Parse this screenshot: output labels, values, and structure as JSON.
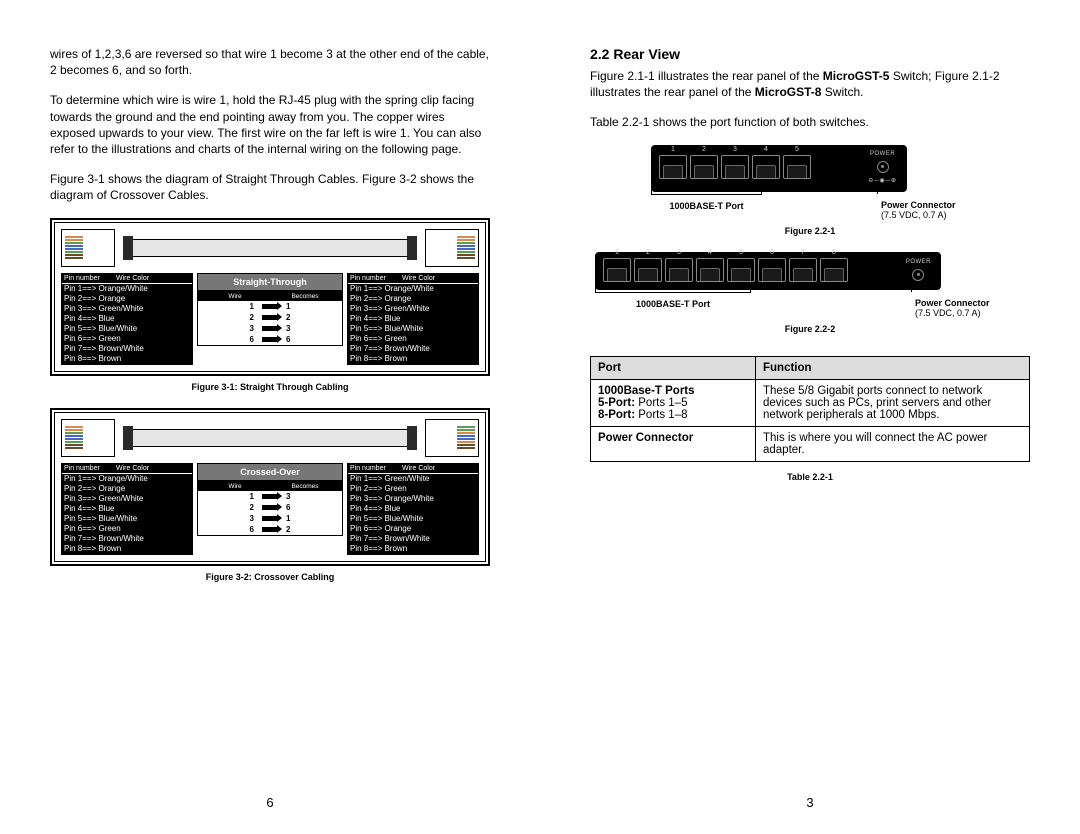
{
  "left": {
    "para1": "wires of 1,2,3,6 are reversed so that wire 1 become 3 at the other end of the cable, 2 becomes 6, and so forth.",
    "para2": "To determine which wire is wire 1, hold the RJ-45 plug with the spring clip facing towards the ground and the end pointing away from you. The copper wires exposed upwards to your view. The first wire on the far left is wire 1. You can also refer to the illustrations and charts of the internal wiring on the following page.",
    "para3": "Figure 3-1 shows the diagram of Straight Through Cables. Figure 3-2 shows the diagram of Crossover Cables.",
    "fig1_caption": "Figure 3-1: Straight Through Cabling",
    "fig2_caption": "Figure 3-2: Crossover Cabling",
    "pin_header_a": "Pin number",
    "pin_header_b": "Wire Color",
    "pins_straight": [
      "Pin 1==>  Orange/White",
      "Pin 2==>  Orange",
      "Pin 3==>  Green/White",
      "Pin 4==>  Blue",
      "Pin 5==>  Blue/White",
      "Pin 6==>  Green",
      "Pin 7==>  Brown/White",
      "Pin 8==>  Brown"
    ],
    "pins_cross_left": [
      "Pin 1==>  Orange/White",
      "Pin 2==>  Orange",
      "Pin 3==>  Green/White",
      "Pin 4==>  Blue",
      "Pin 5==>  Blue/White",
      "Pin 6==>  Green",
      "Pin 7==>  Brown/White",
      "Pin 8==>  Brown"
    ],
    "pins_cross_right": [
      "Pin 1==>  Green/White",
      "Pin 2==>  Green",
      "Pin 3==>  Orange/White",
      "Pin 4==>  Blue",
      "Pin 5==>  Blue/White",
      "Pin 6==>  Orange",
      "Pin 7==>  Brown/White",
      "Pin 8==>  Brown"
    ],
    "center_label_1": "Straight-Through",
    "center_label_2": "Crossed-Over",
    "map_hdr_a": "Wire",
    "map_hdr_b": "Becomes",
    "map_straight": [
      {
        "a": "1",
        "b": "1"
      },
      {
        "a": "2",
        "b": "2"
      },
      {
        "a": "3",
        "b": "3"
      },
      {
        "a": "6",
        "b": "6"
      }
    ],
    "map_cross": [
      {
        "a": "1",
        "b": "3"
      },
      {
        "a": "2",
        "b": "6"
      },
      {
        "a": "3",
        "b": "1"
      },
      {
        "a": "6",
        "b": "2"
      }
    ],
    "pagenum": "6"
  },
  "right": {
    "section_title": "2.2 Rear View",
    "para1_a": "Figure 2.1-1 illustrates the rear panel of the ",
    "para1_b": "MicroGST-5",
    "para1_c": " Switch; Figure 2.1-2 illustrates the rear panel of the ",
    "para1_d": "MicroGST-8",
    "para1_e": " Switch.",
    "para2": "Table 2.2-1 shows the port function of both switches.",
    "callout_ports": "1000BASE-T Port",
    "callout_pwr1": "Power Connector",
    "callout_pwr2": "(7.5 VDC, 0.7 A)",
    "fig221": "Figure 2.2-1",
    "fig222": "Figure 2.2-2",
    "switch_power_label": "POWER",
    "port_nums_5": [
      "1",
      "2",
      "3",
      "4",
      "5"
    ],
    "port_nums_8": [
      "1",
      "2",
      "3",
      "4",
      "5",
      "6",
      "7",
      "8"
    ],
    "table": {
      "h1": "Port",
      "h2": "Function",
      "r1_a": "1000Base-T Ports",
      "r1_b": "5-Port:",
      "r1_b2": " Ports 1–5",
      "r1_c": "8-Port:",
      "r1_c2": " Ports 1–8",
      "r1_func": "These 5/8 Gigabit ports connect to network devices such as PCs, print servers and other network peripherals at 1000 Mbps.",
      "r2_a": "Power Connector",
      "r2_func": "This is where you will connect the AC power adapter.",
      "caption": "Table 2.2-1"
    },
    "pagenum": "3"
  }
}
